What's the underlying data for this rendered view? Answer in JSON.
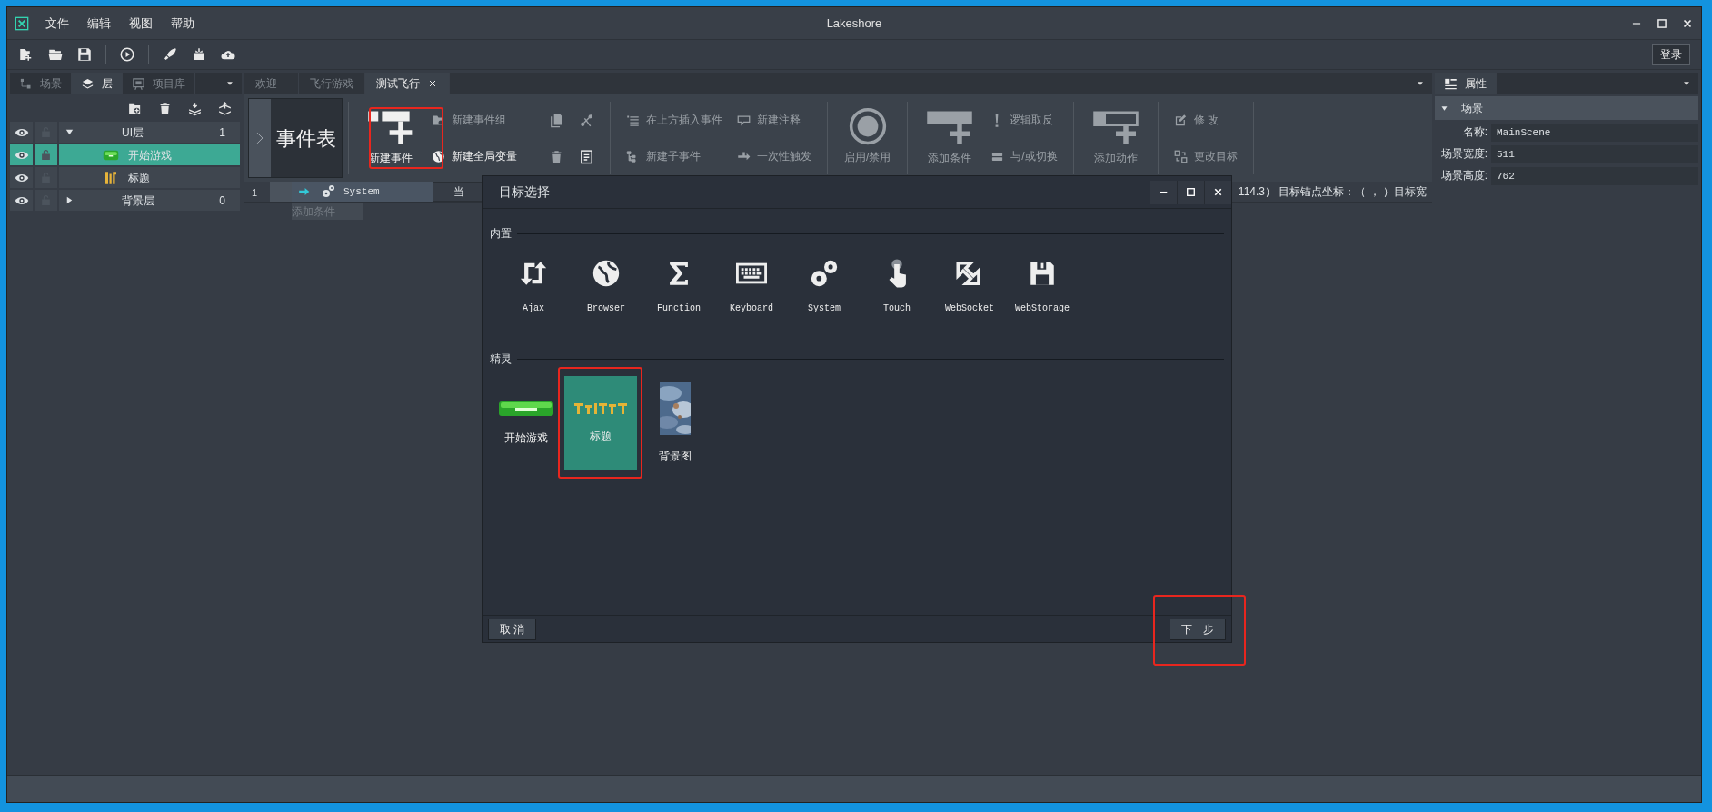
{
  "window": {
    "title": "Lakeshore"
  },
  "menu": [
    "文件",
    "编辑",
    "视图",
    "帮助"
  ],
  "toolbar": {
    "tools": [
      {
        "kind": "new_project"
      },
      {
        "kind": "open"
      },
      {
        "kind": "save"
      },
      {
        "kind": "preview"
      },
      {
        "kind": "publish"
      },
      {
        "kind": "package"
      },
      {
        "kind": "upload"
      }
    ],
    "login": "登录"
  },
  "left_panel": {
    "tabs": [
      {
        "label": "场景",
        "kind": "scene",
        "selected": false
      },
      {
        "label": "层",
        "kind": "layers",
        "selected": true
      },
      {
        "label": "项目库",
        "kind": "library",
        "selected": false
      }
    ],
    "layers": [
      {
        "name": "UI层",
        "count": "1",
        "visible": true,
        "expanded": true,
        "children": [
          {
            "name": "开始游戏",
            "kind": "button",
            "visible": true,
            "selected": true
          },
          {
            "name": "标题",
            "kind": "title",
            "visible": true,
            "selected": false
          }
        ]
      },
      {
        "name": "背景层",
        "count": "0",
        "visible": true,
        "expanded": false
      }
    ]
  },
  "doc_tabs": [
    {
      "label": "欢迎",
      "selected": false
    },
    {
      "label": "飞行游戏",
      "selected": false
    },
    {
      "label": "测试飞行",
      "selected": true
    }
  ],
  "ribbon": {
    "title": "事件表",
    "groups": [
      {
        "columns": [
          {
            "kind": "big",
            "items": [
              {
                "label": "新建事件",
                "kind": "new_event",
                "disabled": false
              }
            ]
          },
          {
            "kind": "stack",
            "items": [
              {
                "label": "新建事件组",
                "kind": "folder_group",
                "disabled": true
              },
              {
                "label": "新建全局变量",
                "kind": "globe",
                "disabled": false
              }
            ]
          }
        ]
      },
      {
        "columns": [
          {
            "kind": "icons",
            "items": [
              {
                "kind": "copy",
                "disabled": true
              },
              {
                "kind": "trash",
                "disabled": true
              }
            ]
          },
          {
            "kind": "icons",
            "items": [
              {
                "kind": "cut",
                "disabled": true
              },
              {
                "kind": "paste",
                "disabled": false
              }
            ]
          }
        ]
      },
      {
        "columns": [
          {
            "kind": "stack",
            "items": [
              {
                "label": "在上方插入事件",
                "kind": "insert",
                "disabled": true
              },
              {
                "label": "新建子事件",
                "kind": "tree",
                "disabled": true
              }
            ]
          },
          {
            "kind": "stack",
            "items": [
              {
                "label": "新建注释",
                "kind": "comment",
                "disabled": true
              },
              {
                "label": "一次性触发",
                "kind": "trigger",
                "disabled": true
              }
            ]
          }
        ]
      },
      {
        "columns": [
          {
            "kind": "big",
            "items": [
              {
                "label": "启用/禁用",
                "kind": "toggle",
                "disabled": true
              }
            ]
          }
        ]
      },
      {
        "columns": [
          {
            "kind": "big",
            "items": [
              {
                "label": "添加条件",
                "kind": "add_condition",
                "disabled": true
              }
            ]
          },
          {
            "kind": "stack",
            "items": [
              {
                "label": "逻辑取反",
                "kind": "invert",
                "disabled": true
              },
              {
                "label": "与/或切换",
                "kind": "and_or",
                "disabled": true
              }
            ]
          }
        ]
      },
      {
        "columns": [
          {
            "kind": "big",
            "items": [
              {
                "label": "添加动作",
                "kind": "add_action",
                "disabled": true
              }
            ]
          }
        ]
      },
      {
        "columns": [
          {
            "kind": "stack",
            "items": [
              {
                "label": "修 改",
                "kind": "edit",
                "disabled": true
              },
              {
                "label": "更改目标",
                "kind": "swap",
                "disabled": true
              }
            ]
          }
        ]
      }
    ]
  },
  "event_sheet": {
    "rows": [
      {
        "number": "1",
        "object": "System",
        "action": "当",
        "condition_hint": "添加条件",
        "info": "114.3） 目标锚点坐标：（ ， ）目标宽"
      }
    ]
  },
  "properties": {
    "tab": "属性",
    "section": "场景",
    "expanded": true,
    "rows": [
      {
        "label": "名称:",
        "value": "MainScene"
      },
      {
        "label": "场景宽度:",
        "value": "511"
      },
      {
        "label": "场景高度:",
        "value": "762"
      }
    ]
  },
  "dialog": {
    "title": "目标选择",
    "sections": [
      {
        "title": "内置",
        "items": [
          {
            "label": "Ajax",
            "kind": "ajax",
            "selected": false
          },
          {
            "label": "Browser",
            "kind": "browser",
            "selected": false
          },
          {
            "label": "Function",
            "kind": "function",
            "selected": false
          },
          {
            "label": "Keyboard",
            "kind": "keyboard",
            "selected": false
          },
          {
            "label": "System",
            "kind": "system",
            "selected": false
          },
          {
            "label": "Touch",
            "kind": "touch",
            "selected": false
          },
          {
            "label": "WebSocket",
            "kind": "websocket",
            "selected": false
          },
          {
            "label": "WebStorage",
            "kind": "storage",
            "selected": false
          }
        ]
      },
      {
        "title": "精灵",
        "items": [
          {
            "label": "开始游戏",
            "kind": "button_sprite",
            "selected": false
          },
          {
            "label": "标题",
            "kind": "title_sprite",
            "selected": true
          },
          {
            "label": "背景图",
            "kind": "picture",
            "selected": false
          }
        ]
      }
    ],
    "cancel": "取 消",
    "next": "下一步"
  }
}
